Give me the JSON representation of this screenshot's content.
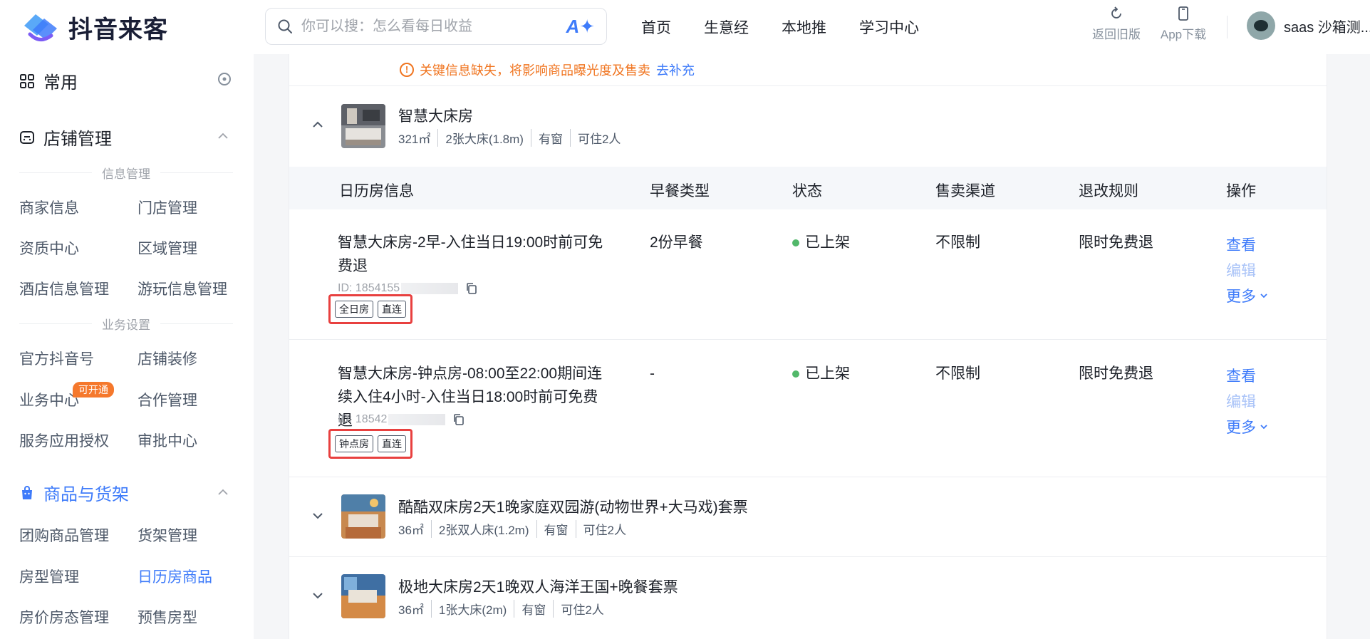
{
  "app": {
    "logo_text": "抖音来客"
  },
  "search": {
    "placeholder": "你可以搜：怎么看每日收益"
  },
  "nav": [
    "首页",
    "生意经",
    "本地推",
    "学习中心"
  ],
  "tools": {
    "back_label": "返回旧版",
    "app_label": "App下载"
  },
  "user": {
    "name": "saas 沙箱测..."
  },
  "sidebar": {
    "common_label": "常用",
    "store_label": "店铺管理",
    "info_group": "信息管理",
    "info_items": [
      "商家信息",
      "门店管理",
      "资质中心",
      "区域管理",
      "酒店信息管理",
      "游玩信息管理"
    ],
    "biz_group": "业务设置",
    "biz_items": [
      "官方抖音号",
      "店铺装修",
      "业务中心",
      "合作管理",
      "服务应用授权",
      "审批中心"
    ],
    "biz_badge": "可开通",
    "goods_label": "商品与货架",
    "goods_items": [
      "团购商品管理",
      "货架管理",
      "房型管理",
      "日历房商品",
      "房价房态管理",
      "预售房型"
    ]
  },
  "main": {
    "warning": "关键信息缺失，将影响商品曝光度及售卖",
    "warning_link": "去补充",
    "rooms": [
      {
        "title": "智慧大床房",
        "meta": [
          "321㎡",
          "2张大床(1.8m)",
          "有窗",
          "可住2人"
        ]
      },
      {
        "title": "酷酷双床房2天1晚家庭双园游(动物世界+大马戏)套票",
        "meta": [
          "36㎡",
          "2张双人床(1.2m)",
          "有窗",
          "可住2人"
        ]
      },
      {
        "title": "极地大床房2天1晚双人海洋王国+晚餐套票",
        "meta": [
          "36㎡",
          "1张大床(2m)",
          "有窗",
          "可住2人"
        ]
      }
    ],
    "table_headers": [
      "日历房信息",
      "早餐类型",
      "状态",
      "售卖渠道",
      "退改规则",
      "操作"
    ],
    "products": [
      {
        "name": "智慧大床房-2早-入住当日19:00时前可免费退",
        "id": "ID: 1854155",
        "tags": [
          "全日房",
          "直连"
        ],
        "breakfast": "2份早餐",
        "status": "已上架",
        "channel": "不限制",
        "rule": "限时免费退",
        "ops": [
          "查看",
          "编辑",
          "更多"
        ]
      },
      {
        "name": "智慧大床房-钟点房-08:00至22:00期间连续入住4小时-入住当日18:00时前可免费退",
        "id": "ID: 18542",
        "tags": [
          "钟点房",
          "直连"
        ],
        "breakfast": "-",
        "status": "已上架",
        "channel": "不限制",
        "rule": "限时免费退",
        "ops": [
          "查看",
          "编辑",
          "更多"
        ]
      }
    ]
  },
  "colors": {
    "accent": "#3e7bfa",
    "warning": "#f0741f",
    "status_on": "#52b86a",
    "highlight_box": "#e8403f"
  }
}
